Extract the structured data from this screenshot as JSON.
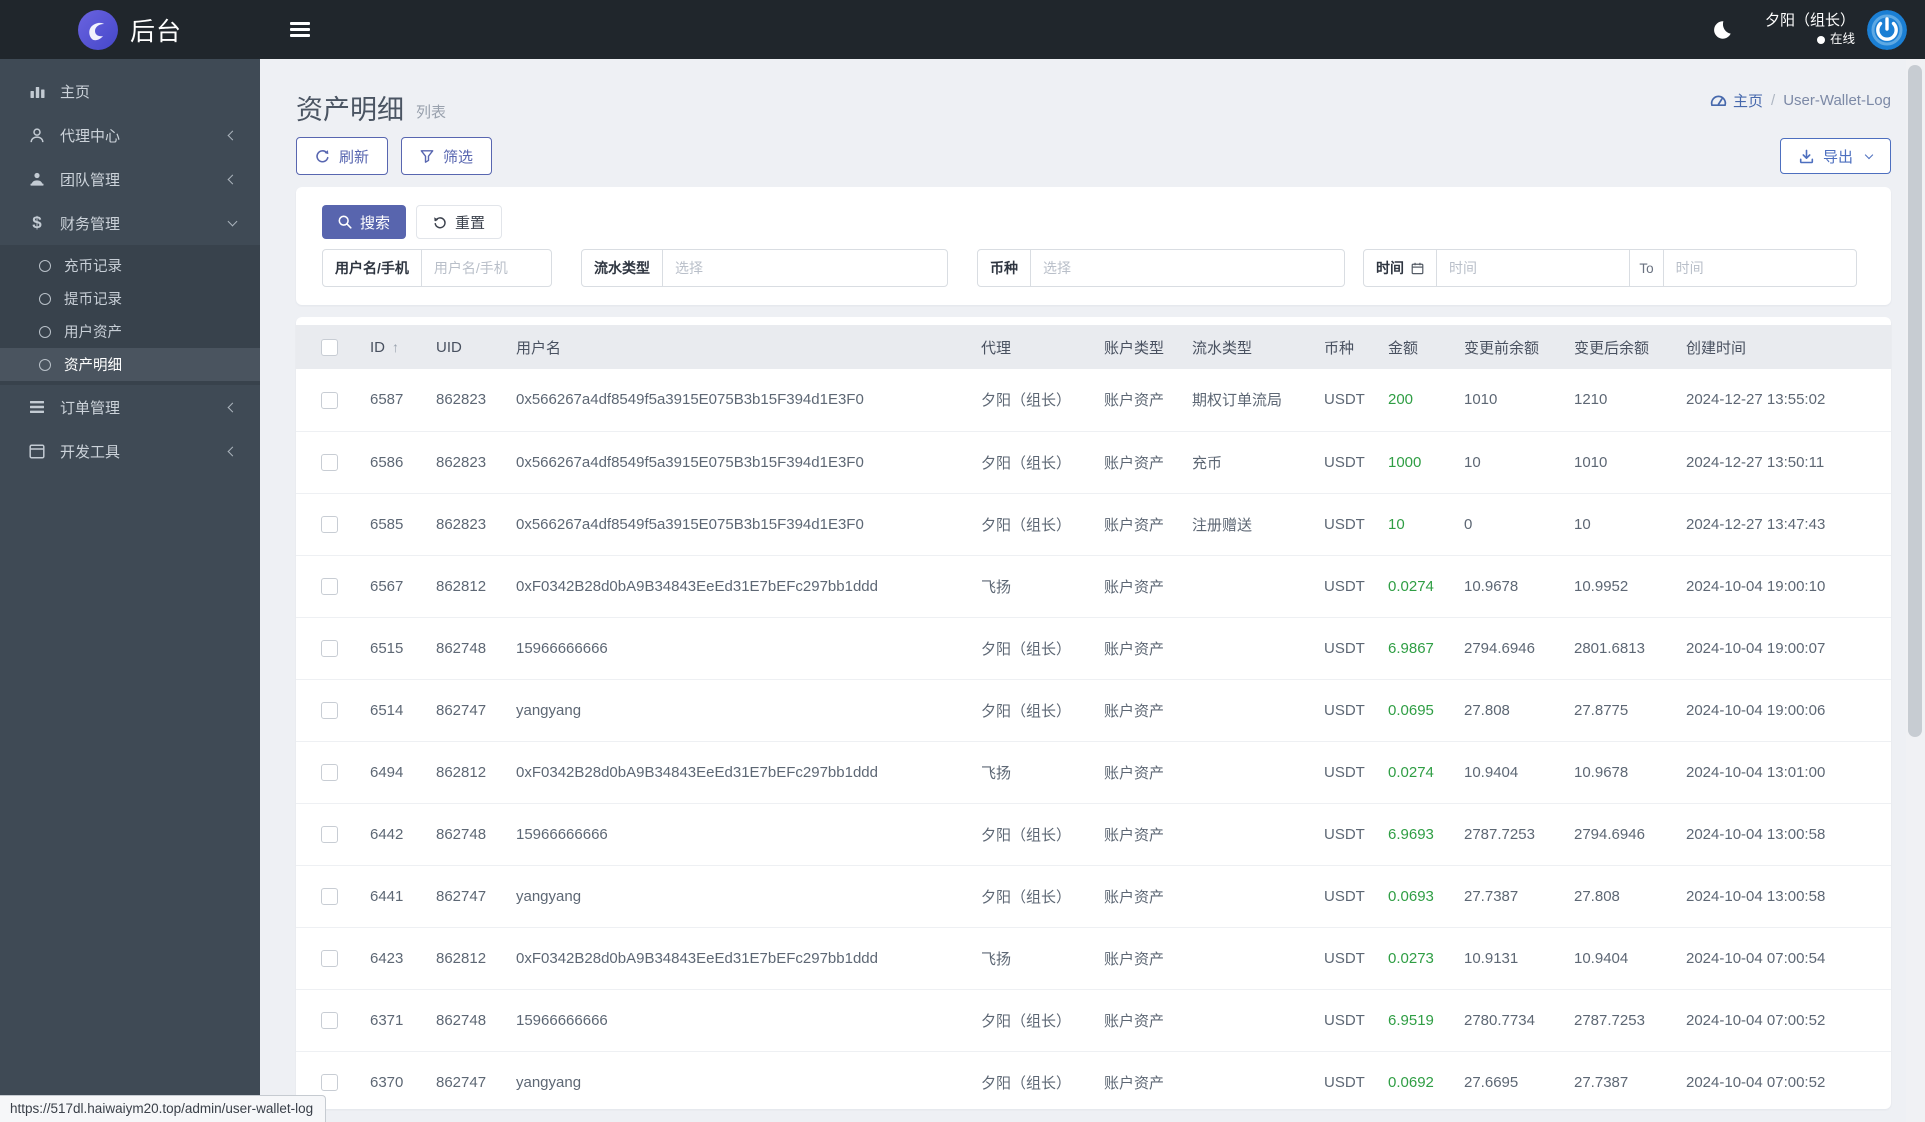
{
  "topbar": {
    "brand": "后台",
    "user_name": "夕阳（组长）",
    "user_status": "在线",
    "icons": [
      "logo-swirl-icon",
      "hamburger-icon",
      "moon-icon",
      "power-icon"
    ]
  },
  "sidebar": {
    "items": [
      {
        "label": "主页",
        "icon": "bar-chart-icon"
      },
      {
        "label": "代理中心",
        "icon": "user-icon",
        "chevron": "left"
      },
      {
        "label": "团队管理",
        "icon": "team-icon",
        "chevron": "left"
      },
      {
        "label": "财务管理",
        "icon": "dollar-icon",
        "chevron": "down",
        "expanded": true,
        "children": [
          {
            "label": "充币记录",
            "active": false
          },
          {
            "label": "提币记录",
            "active": false
          },
          {
            "label": "用户资产",
            "active": false
          },
          {
            "label": "资产明细",
            "active": true
          }
        ]
      },
      {
        "label": "订单管理",
        "icon": "list-icon",
        "chevron": "left"
      },
      {
        "label": "开发工具",
        "icon": "window-icon",
        "chevron": "left"
      }
    ]
  },
  "page": {
    "title": "资产明细",
    "subtitle": "列表",
    "breadcrumb_home": "主页",
    "breadcrumb_sep": "/",
    "breadcrumb_current": "User-Wallet-Log"
  },
  "toolbar": {
    "refresh": "刷新",
    "filter": "筛选",
    "export": "导出"
  },
  "filter_panel": {
    "search": "搜索",
    "reset": "重置",
    "username_label": "用户名/手机",
    "username_placeholder": "用户名/手机",
    "flow_type_label": "流水类型",
    "flow_type_placeholder": "选择",
    "coin_label": "币种",
    "coin_placeholder": "选择",
    "time_label": "时间",
    "time_from_placeholder": "时间",
    "time_separator": "To",
    "time_to_placeholder": "时间"
  },
  "table": {
    "columns": [
      "ID",
      "UID",
      "用户名",
      "代理",
      "账户类型",
      "流水类型",
      "币种",
      "金额",
      "变更前余额",
      "变更后余额",
      "创建时间"
    ],
    "sorted_column": "ID",
    "rows": [
      {
        "id": "6587",
        "uid": "862823",
        "username": "0x566267a4df8549f5a3915E075B3b15F394d1E3F0",
        "agent": "夕阳（组长）",
        "account_type": "账户资产",
        "flow_type": "期权订单流局",
        "coin": "USDT",
        "amount": "200",
        "before_balance": "1010",
        "after_balance": "1210",
        "created_at": "2024-12-27 13:55:02"
      },
      {
        "id": "6586",
        "uid": "862823",
        "username": "0x566267a4df8549f5a3915E075B3b15F394d1E3F0",
        "agent": "夕阳（组长）",
        "account_type": "账户资产",
        "flow_type": "充币",
        "coin": "USDT",
        "amount": "1000",
        "before_balance": "10",
        "after_balance": "1010",
        "created_at": "2024-12-27 13:50:11"
      },
      {
        "id": "6585",
        "uid": "862823",
        "username": "0x566267a4df8549f5a3915E075B3b15F394d1E3F0",
        "agent": "夕阳（组长）",
        "account_type": "账户资产",
        "flow_type": "注册赠送",
        "coin": "USDT",
        "amount": "10",
        "before_balance": "0",
        "after_balance": "10",
        "created_at": "2024-12-27 13:47:43"
      },
      {
        "id": "6567",
        "uid": "862812",
        "username": "0xF0342B28d0bA9B34843EeEd31E7bEFc297bb1ddd",
        "agent": "飞扬",
        "account_type": "账户资产",
        "flow_type": "",
        "coin": "USDT",
        "amount": "0.0274",
        "before_balance": "10.9678",
        "after_balance": "10.9952",
        "created_at": "2024-10-04 19:00:10"
      },
      {
        "id": "6515",
        "uid": "862748",
        "username": "15966666666",
        "agent": "夕阳（组长）",
        "account_type": "账户资产",
        "flow_type": "",
        "coin": "USDT",
        "amount": "6.9867",
        "before_balance": "2794.6946",
        "after_balance": "2801.6813",
        "created_at": "2024-10-04 19:00:07"
      },
      {
        "id": "6514",
        "uid": "862747",
        "username": "yangyang",
        "agent": "夕阳（组长）",
        "account_type": "账户资产",
        "flow_type": "",
        "coin": "USDT",
        "amount": "0.0695",
        "before_balance": "27.808",
        "after_balance": "27.8775",
        "created_at": "2024-10-04 19:00:06"
      },
      {
        "id": "6494",
        "uid": "862812",
        "username": "0xF0342B28d0bA9B34843EeEd31E7bEFc297bb1ddd",
        "agent": "飞扬",
        "account_type": "账户资产",
        "flow_type": "",
        "coin": "USDT",
        "amount": "0.0274",
        "before_balance": "10.9404",
        "after_balance": "10.9678",
        "created_at": "2024-10-04 13:01:00"
      },
      {
        "id": "6442",
        "uid": "862748",
        "username": "15966666666",
        "agent": "夕阳（组长）",
        "account_type": "账户资产",
        "flow_type": "",
        "coin": "USDT",
        "amount": "6.9693",
        "before_balance": "2787.7253",
        "after_balance": "2794.6946",
        "created_at": "2024-10-04 13:00:58"
      },
      {
        "id": "6441",
        "uid": "862747",
        "username": "yangyang",
        "agent": "夕阳（组长）",
        "account_type": "账户资产",
        "flow_type": "",
        "coin": "USDT",
        "amount": "0.0693",
        "before_balance": "27.7387",
        "after_balance": "27.808",
        "created_at": "2024-10-04 13:00:58"
      },
      {
        "id": "6423",
        "uid": "862812",
        "username": "0xF0342B28d0bA9B34843EeEd31E7bEFc297bb1ddd",
        "agent": "飞扬",
        "account_type": "账户资产",
        "flow_type": "",
        "coin": "USDT",
        "amount": "0.0273",
        "before_balance": "10.9131",
        "after_balance": "10.9404",
        "created_at": "2024-10-04 07:00:54"
      },
      {
        "id": "6371",
        "uid": "862748",
        "username": "15966666666",
        "agent": "夕阳（组长）",
        "account_type": "账户资产",
        "flow_type": "",
        "coin": "USDT",
        "amount": "6.9519",
        "before_balance": "2780.7734",
        "after_balance": "2787.7253",
        "created_at": "2024-10-04 07:00:52"
      },
      {
        "id": "6370",
        "uid": "862747",
        "username": "yangyang",
        "agent": "夕阳（组长）",
        "account_type": "账户资产",
        "flow_type": "",
        "coin": "USDT",
        "amount": "0.0692",
        "before_balance": "27.6695",
        "after_balance": "27.7387",
        "created_at": "2024-10-04 07:00:52"
      }
    ]
  },
  "statusbar": {
    "url": "https://517dl.haiwaiym20.top/admin/user-wallet-log"
  },
  "colors": {
    "topbar": "#20262c",
    "sidebar": "#3f4a55",
    "accent_indigo": "#5865ae",
    "outline_blue": "#4d6fbf",
    "link_blue": "#4668ac",
    "amount_green": "#2f9e44",
    "avatar_blue": "#1b7fd4",
    "logo_purple": "#5a5bd8"
  }
}
